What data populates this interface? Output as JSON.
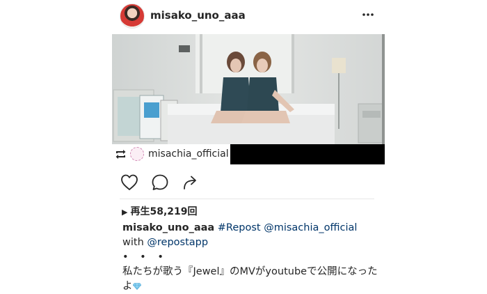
{
  "post": {
    "username": "misako_uno_aaa",
    "more_icon": "more-horizontal-icon"
  },
  "repost": {
    "icon": "repost-icon",
    "source_username": "misachia_official"
  },
  "actions": {
    "like_icon": "heart-icon",
    "comment_icon": "comment-icon",
    "share_icon": "share-icon"
  },
  "views": {
    "label": "再生58,219回"
  },
  "caption": {
    "username": "misako_uno_aaa",
    "hashtag": "#Repost",
    "mention": "@misachia_official",
    "with_word": "with",
    "mention2": "@repostapp",
    "dots": "• • •",
    "text": "私たちが歌う『Jewel』のMVがyoutubeで公開になったよ",
    "emoji": "gem-icon"
  },
  "colors": {
    "text": "#262626",
    "link": "#003569",
    "divider": "#e6e6e6"
  }
}
